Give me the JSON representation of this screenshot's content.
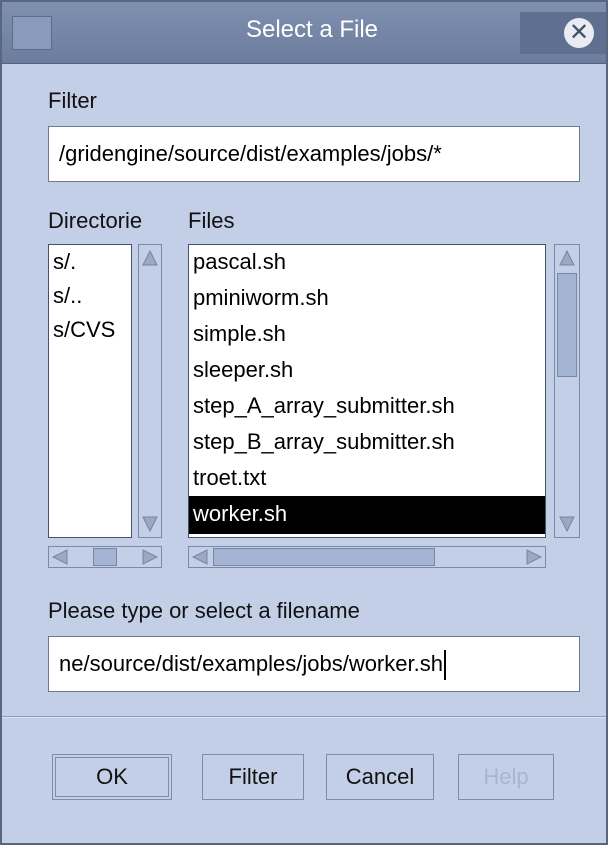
{
  "window": {
    "title": "Select a File"
  },
  "filter": {
    "label": "Filter",
    "value": "/gridengine/source/dist/examples/jobs/*"
  },
  "directories": {
    "label": "Directorie",
    "items": [
      "s/.",
      "s/..",
      "s/CVS"
    ]
  },
  "files": {
    "label": "Files",
    "items": [
      "pascal.sh",
      "pminiworm.sh",
      "simple.sh",
      "sleeper.sh",
      "step_A_array_submitter.sh",
      "step_B_array_submitter.sh",
      "troet.txt",
      "worker.sh"
    ],
    "selected": "worker.sh"
  },
  "filename": {
    "label": "Please type or select a filename",
    "value": "ne/source/dist/examples/jobs/worker.sh"
  },
  "buttons": {
    "ok": "OK",
    "filter": "Filter",
    "cancel": "Cancel",
    "help": "Help"
  },
  "icons": {
    "close": "close-icon",
    "window_menu": "window-menu-icon"
  }
}
